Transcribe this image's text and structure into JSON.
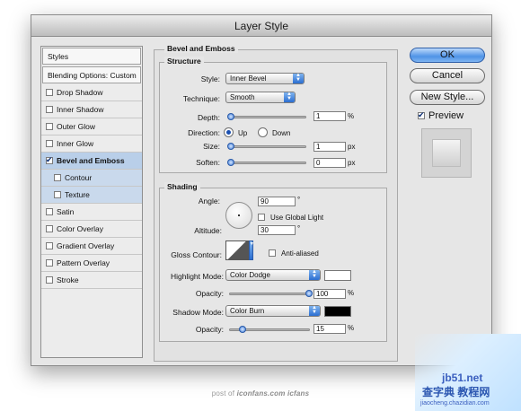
{
  "window": {
    "title": "Layer Style"
  },
  "styles_list": {
    "header": "Styles",
    "blending": "Blending Options: Custom",
    "items": [
      {
        "label": "Drop Shadow",
        "checked": false
      },
      {
        "label": "Inner Shadow",
        "checked": false
      },
      {
        "label": "Outer Glow",
        "checked": false
      },
      {
        "label": "Inner Glow",
        "checked": false
      },
      {
        "label": "Bevel and Emboss",
        "checked": true,
        "selected": true
      },
      {
        "label": "Contour",
        "checked": false,
        "sub": true
      },
      {
        "label": "Texture",
        "checked": false,
        "sub": true
      },
      {
        "label": "Satin",
        "checked": false
      },
      {
        "label": "Color Overlay",
        "checked": false
      },
      {
        "label": "Gradient Overlay",
        "checked": false
      },
      {
        "label": "Pattern Overlay",
        "checked": false
      },
      {
        "label": "Stroke",
        "checked": false
      }
    ]
  },
  "bevel": {
    "section_title": "Bevel and Emboss",
    "structure_title": "Structure",
    "style_label": "Style:",
    "style_value": "Inner Bevel",
    "technique_label": "Technique:",
    "technique_value": "Smooth",
    "depth_label": "Depth:",
    "depth_value": "1",
    "depth_unit": "%",
    "direction_label": "Direction:",
    "direction_up": "Up",
    "direction_down": "Down",
    "direction_selected": "Up",
    "size_label": "Size:",
    "size_value": "1",
    "size_unit": "px",
    "soften_label": "Soften:",
    "soften_value": "0",
    "soften_unit": "px"
  },
  "shading": {
    "title": "Shading",
    "angle_label": "Angle:",
    "angle_value": "90",
    "angle_unit": "°",
    "global_light_label": "Use Global Light",
    "global_light_checked": false,
    "altitude_label": "Altitude:",
    "altitude_value": "30",
    "altitude_unit": "°",
    "gloss_label": "Gloss Contour:",
    "anti_aliased_label": "Anti-aliased",
    "anti_aliased_checked": false,
    "highlight_mode_label": "Highlight Mode:",
    "highlight_mode_value": "Color Dodge",
    "highlight_color": "#ffffff",
    "highlight_opacity_label": "Opacity:",
    "highlight_opacity_value": "100",
    "highlight_opacity_unit": "%",
    "shadow_mode_label": "Shadow Mode:",
    "shadow_mode_value": "Color Burn",
    "shadow_color": "#000000",
    "shadow_opacity_label": "Opacity:",
    "shadow_opacity_value": "15",
    "shadow_opacity_unit": "%"
  },
  "buttons": {
    "ok": "OK",
    "cancel": "Cancel",
    "new_style": "New Style...",
    "preview_label": "Preview",
    "preview_checked": true
  },
  "footer": {
    "prefix": "post of",
    "site": "iconfans.com",
    "brand": "icfans"
  },
  "watermark": {
    "domain": "jb51.net",
    "cn": "查字典 教程网",
    "sub": "jiaocheng.chazidian.com"
  }
}
